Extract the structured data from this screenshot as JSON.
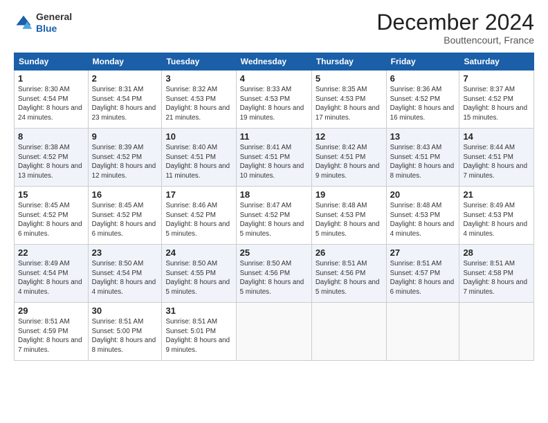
{
  "header": {
    "logo": {
      "line1": "General",
      "line2": "Blue"
    },
    "title": "December 2024",
    "subtitle": "Bouttencourt, France"
  },
  "weekdays": [
    "Sunday",
    "Monday",
    "Tuesday",
    "Wednesday",
    "Thursday",
    "Friday",
    "Saturday"
  ],
  "weeks": [
    [
      {
        "day": 1,
        "sunrise": "8:30 AM",
        "sunset": "4:54 PM",
        "daylight": "8 hours and 24 minutes."
      },
      {
        "day": 2,
        "sunrise": "8:31 AM",
        "sunset": "4:54 PM",
        "daylight": "8 hours and 23 minutes."
      },
      {
        "day": 3,
        "sunrise": "8:32 AM",
        "sunset": "4:53 PM",
        "daylight": "8 hours and 21 minutes."
      },
      {
        "day": 4,
        "sunrise": "8:33 AM",
        "sunset": "4:53 PM",
        "daylight": "8 hours and 19 minutes."
      },
      {
        "day": 5,
        "sunrise": "8:35 AM",
        "sunset": "4:53 PM",
        "daylight": "8 hours and 17 minutes."
      },
      {
        "day": 6,
        "sunrise": "8:36 AM",
        "sunset": "4:52 PM",
        "daylight": "8 hours and 16 minutes."
      },
      {
        "day": 7,
        "sunrise": "8:37 AM",
        "sunset": "4:52 PM",
        "daylight": "8 hours and 15 minutes."
      }
    ],
    [
      {
        "day": 8,
        "sunrise": "8:38 AM",
        "sunset": "4:52 PM",
        "daylight": "8 hours and 13 minutes."
      },
      {
        "day": 9,
        "sunrise": "8:39 AM",
        "sunset": "4:52 PM",
        "daylight": "8 hours and 12 minutes."
      },
      {
        "day": 10,
        "sunrise": "8:40 AM",
        "sunset": "4:51 PM",
        "daylight": "8 hours and 11 minutes."
      },
      {
        "day": 11,
        "sunrise": "8:41 AM",
        "sunset": "4:51 PM",
        "daylight": "8 hours and 10 minutes."
      },
      {
        "day": 12,
        "sunrise": "8:42 AM",
        "sunset": "4:51 PM",
        "daylight": "8 hours and 9 minutes."
      },
      {
        "day": 13,
        "sunrise": "8:43 AM",
        "sunset": "4:51 PM",
        "daylight": "8 hours and 8 minutes."
      },
      {
        "day": 14,
        "sunrise": "8:44 AM",
        "sunset": "4:51 PM",
        "daylight": "8 hours and 7 minutes."
      }
    ],
    [
      {
        "day": 15,
        "sunrise": "8:45 AM",
        "sunset": "4:52 PM",
        "daylight": "8 hours and 6 minutes."
      },
      {
        "day": 16,
        "sunrise": "8:45 AM",
        "sunset": "4:52 PM",
        "daylight": "8 hours and 6 minutes."
      },
      {
        "day": 17,
        "sunrise": "8:46 AM",
        "sunset": "4:52 PM",
        "daylight": "8 hours and 5 minutes."
      },
      {
        "day": 18,
        "sunrise": "8:47 AM",
        "sunset": "4:52 PM",
        "daylight": "8 hours and 5 minutes."
      },
      {
        "day": 19,
        "sunrise": "8:48 AM",
        "sunset": "4:53 PM",
        "daylight": "8 hours and 5 minutes."
      },
      {
        "day": 20,
        "sunrise": "8:48 AM",
        "sunset": "4:53 PM",
        "daylight": "8 hours and 4 minutes."
      },
      {
        "day": 21,
        "sunrise": "8:49 AM",
        "sunset": "4:53 PM",
        "daylight": "8 hours and 4 minutes."
      }
    ],
    [
      {
        "day": 22,
        "sunrise": "8:49 AM",
        "sunset": "4:54 PM",
        "daylight": "8 hours and 4 minutes."
      },
      {
        "day": 23,
        "sunrise": "8:50 AM",
        "sunset": "4:54 PM",
        "daylight": "8 hours and 4 minutes."
      },
      {
        "day": 24,
        "sunrise": "8:50 AM",
        "sunset": "4:55 PM",
        "daylight": "8 hours and 5 minutes."
      },
      {
        "day": 25,
        "sunrise": "8:50 AM",
        "sunset": "4:56 PM",
        "daylight": "8 hours and 5 minutes."
      },
      {
        "day": 26,
        "sunrise": "8:51 AM",
        "sunset": "4:56 PM",
        "daylight": "8 hours and 5 minutes."
      },
      {
        "day": 27,
        "sunrise": "8:51 AM",
        "sunset": "4:57 PM",
        "daylight": "8 hours and 6 minutes."
      },
      {
        "day": 28,
        "sunrise": "8:51 AM",
        "sunset": "4:58 PM",
        "daylight": "8 hours and 7 minutes."
      }
    ],
    [
      {
        "day": 29,
        "sunrise": "8:51 AM",
        "sunset": "4:59 PM",
        "daylight": "8 hours and 7 minutes."
      },
      {
        "day": 30,
        "sunrise": "8:51 AM",
        "sunset": "5:00 PM",
        "daylight": "8 hours and 8 minutes."
      },
      {
        "day": 31,
        "sunrise": "8:51 AM",
        "sunset": "5:01 PM",
        "daylight": "8 hours and 9 minutes."
      },
      null,
      null,
      null,
      null
    ]
  ]
}
